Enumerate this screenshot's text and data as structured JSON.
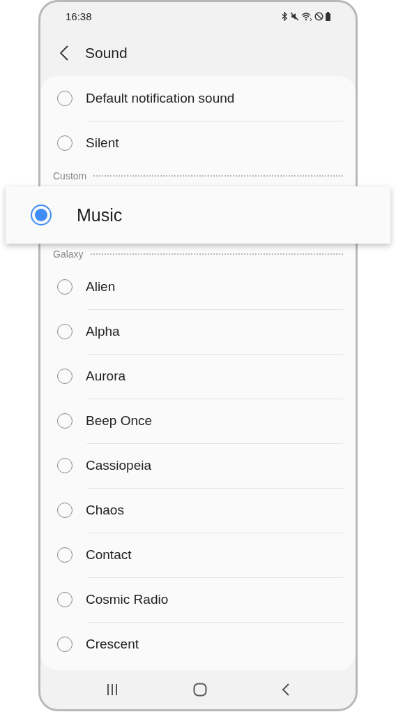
{
  "status_bar": {
    "time": "16:38"
  },
  "header": {
    "title": "Sound"
  },
  "items": [
    {
      "kind": "option",
      "label": "Default notification sound",
      "selected": false
    },
    {
      "kind": "option",
      "label": "Silent",
      "selected": false
    },
    {
      "kind": "header",
      "label": "Custom"
    },
    {
      "kind": "highlight",
      "label": "Music",
      "selected": true
    },
    {
      "kind": "header",
      "label": "Galaxy"
    },
    {
      "kind": "option",
      "label": "Alien",
      "selected": false
    },
    {
      "kind": "option",
      "label": "Alpha",
      "selected": false
    },
    {
      "kind": "option",
      "label": "Aurora",
      "selected": false
    },
    {
      "kind": "option",
      "label": "Beep Once",
      "selected": false
    },
    {
      "kind": "option",
      "label": "Cassiopeia",
      "selected": false
    },
    {
      "kind": "option",
      "label": "Chaos",
      "selected": false
    },
    {
      "kind": "option",
      "label": "Contact",
      "selected": false
    },
    {
      "kind": "option",
      "label": "Cosmic Radio",
      "selected": false
    },
    {
      "kind": "option",
      "label": "Crescent",
      "selected": false
    }
  ]
}
